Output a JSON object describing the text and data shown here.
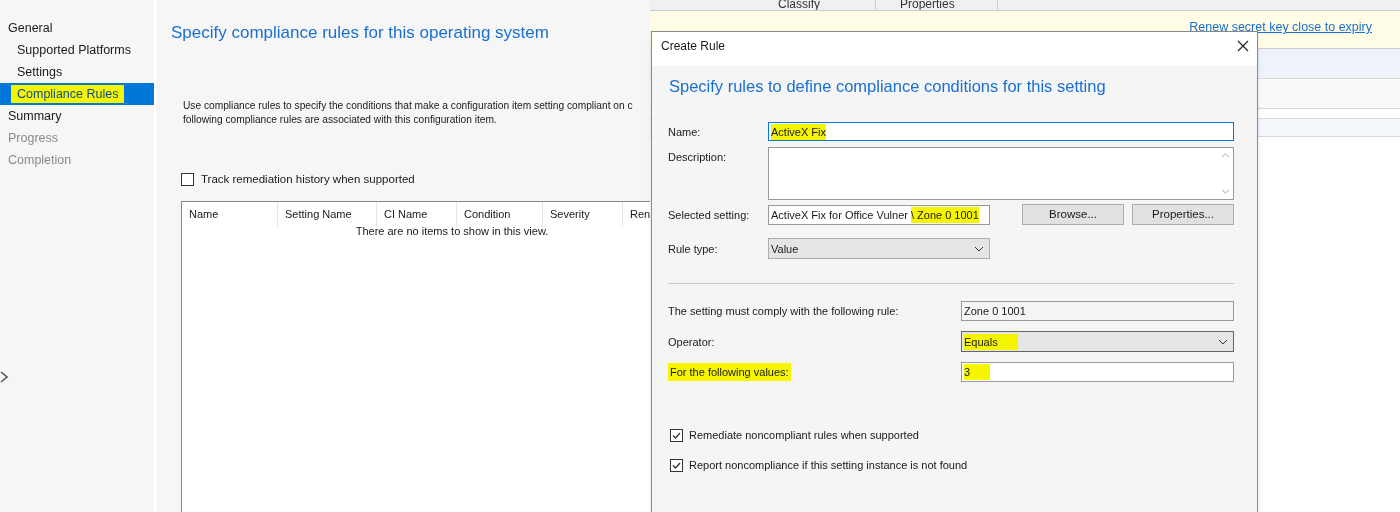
{
  "wizard": {
    "nav": [
      {
        "label": "General",
        "selected": false,
        "disabled": false,
        "highlighted": false,
        "children": [
          {
            "label": "Supported Platforms",
            "selected": false,
            "disabled": false,
            "highlighted": false
          },
          {
            "label": "Settings",
            "selected": false,
            "disabled": false,
            "highlighted": false
          },
          {
            "label": "Compliance Rules",
            "selected": true,
            "disabled": false,
            "highlighted": true
          }
        ]
      },
      {
        "label": "Summary",
        "selected": false,
        "disabled": false,
        "highlighted": false
      },
      {
        "label": "Progress",
        "selected": false,
        "disabled": true,
        "highlighted": false
      },
      {
        "label": "Completion",
        "selected": false,
        "disabled": true,
        "highlighted": false
      }
    ],
    "heading": "Specify compliance rules for this operating system",
    "intro": [
      "Use compliance rules to specify the conditions that make a configuration item setting compliant on c",
      "following compliance rules are associated with this configuration item."
    ],
    "track_checkbox": {
      "label": "Track remediation history when supported",
      "checked": false
    },
    "table": {
      "columns": [
        "Name",
        "Setting Name",
        "CI Name",
        "Condition",
        "Severity",
        "Ren"
      ],
      "empty_message": "There are no items to show in this view."
    }
  },
  "console": {
    "tabs": [
      "Classify",
      "Properties"
    ],
    "link": "Renew secret key close to expiry"
  },
  "dialog": {
    "title": "Create Rule",
    "heading": "Specify rules to define compliance conditions for this setting",
    "name": {
      "label": "Name:",
      "value": "ActiveX Fix",
      "highlighted": true
    },
    "description": {
      "label": "Description:"
    },
    "selected_setting": {
      "label": "Selected setting:",
      "value": "ActiveX Fix for Office Vulner",
      "value_tail": "\\ Zone 0 1001",
      "highlighted": true
    },
    "buttons": [
      "Browse...",
      "Properties..."
    ],
    "rule_type": {
      "label": "Rule type:",
      "value": "Value"
    },
    "rule": {
      "label": "The setting must comply with the following rule:",
      "value": "Zone 0 1001"
    },
    "operator": {
      "label": "Operator:",
      "value": "Equals",
      "highlighted": true
    },
    "values": {
      "label": "For the following values:",
      "value": "3",
      "highlighted": true
    },
    "options": [
      {
        "label": "Remediate noncompliant rules when supported",
        "checked": true
      },
      {
        "label": "Report noncompliance if this setting instance is not found",
        "checked": true
      }
    ]
  }
}
